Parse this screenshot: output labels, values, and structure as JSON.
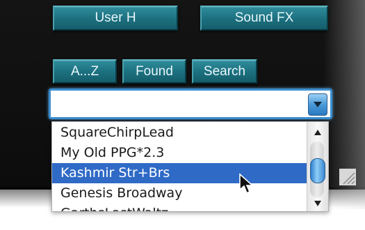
{
  "buttons": {
    "user_label": "User H",
    "sound_label": "Sound FX"
  },
  "tabs": [
    {
      "label": "A...Z"
    },
    {
      "label": "Found"
    },
    {
      "label": "Search"
    }
  ],
  "combo": {
    "value": ""
  },
  "list": {
    "items": [
      {
        "label": "SquareChirpLead"
      },
      {
        "label": "My Old PPG*2.3"
      },
      {
        "label": "Kashmir Str+Brs"
      },
      {
        "label": "Genesis Broadway"
      },
      {
        "label": "GarthsLastWaltz"
      }
    ],
    "selected": "Kashmir Str+Brs"
  },
  "icons": {
    "dropdown": "chevron-down-icon",
    "scroll_up": "arrow-up-icon",
    "scroll_down": "arrow-down-icon",
    "cursor": "mouse-pointer-icon",
    "resize": "resize-grip-icon"
  },
  "colors": {
    "button_teal": "#1c6f7e",
    "selection_blue": "#2f6ac6",
    "focus_ring": "#3c8fd0",
    "panel_bg": "#111111"
  }
}
